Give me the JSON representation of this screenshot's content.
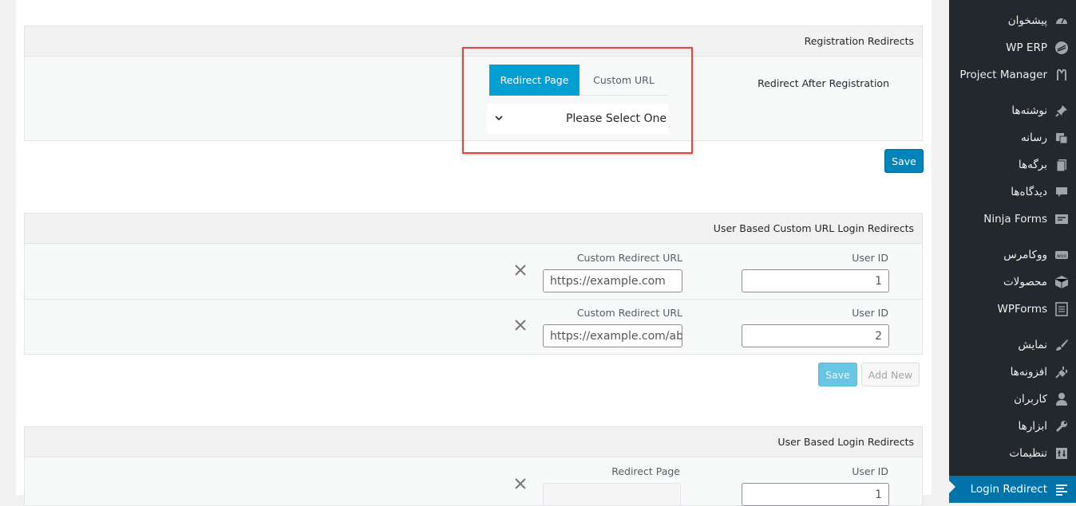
{
  "registration_panel": {
    "title": "Registration Redirects",
    "row_label": "Redirect After Registration",
    "tabs": [
      {
        "label": "Redirect Page",
        "active": true
      },
      {
        "label": "Custom URL",
        "active": false
      }
    ],
    "select_value": "Please Select One",
    "save_label": "Save"
  },
  "custom_url_panel": {
    "title": "User Based Custom URL Login Redirects",
    "user_id_label": "User ID",
    "url_label": "Custom Redirect URL",
    "rows": [
      {
        "user_id": "1",
        "url": "https://example.com"
      },
      {
        "user_id": "2",
        "url": "https://example.com/abo"
      }
    ],
    "save_label": "Save",
    "add_new_label": "Add New"
  },
  "login_panel": {
    "title": "User Based Login Redirects",
    "user_id_label": "User ID",
    "page_label": "Redirect Page",
    "rows": [
      {
        "user_id": "1"
      }
    ]
  },
  "sidebar": {
    "items": [
      {
        "label": "پیشخوان",
        "icon": "dashboard-icon"
      },
      {
        "label": "WP ERP",
        "icon": "erp-icon"
      },
      {
        "label": "Project Manager",
        "icon": "project-manager-icon"
      },
      {
        "label": "نوشته‌ها",
        "icon": "pin-icon"
      },
      {
        "label": "رسانه",
        "icon": "media-icon"
      },
      {
        "label": "برگه‌ها",
        "icon": "pages-icon"
      },
      {
        "label": "دیدگاه‌ها",
        "icon": "comments-icon"
      },
      {
        "label": "Ninja Forms",
        "icon": "forms-icon"
      },
      {
        "label": "ووکامرس",
        "icon": "woo-icon"
      },
      {
        "label": "محصولات",
        "icon": "box-icon"
      },
      {
        "label": "WPForms",
        "icon": "wpforms-icon"
      },
      {
        "label": "نمایش",
        "icon": "brush-icon"
      },
      {
        "label": "افزونه‌ها",
        "icon": "plugin-icon"
      },
      {
        "label": "کاربران",
        "icon": "users-icon"
      },
      {
        "label": "ابزارها",
        "icon": "wrench-icon"
      },
      {
        "label": "تنظیمات",
        "icon": "settings-icon"
      },
      {
        "label": "Login Redirect",
        "icon": "list-icon",
        "active": true
      }
    ]
  },
  "colors": {
    "accent": "#0085ba",
    "sidebar_bg": "#23282d",
    "highlight": "#e0463f",
    "active_menu": "#0073aa"
  }
}
